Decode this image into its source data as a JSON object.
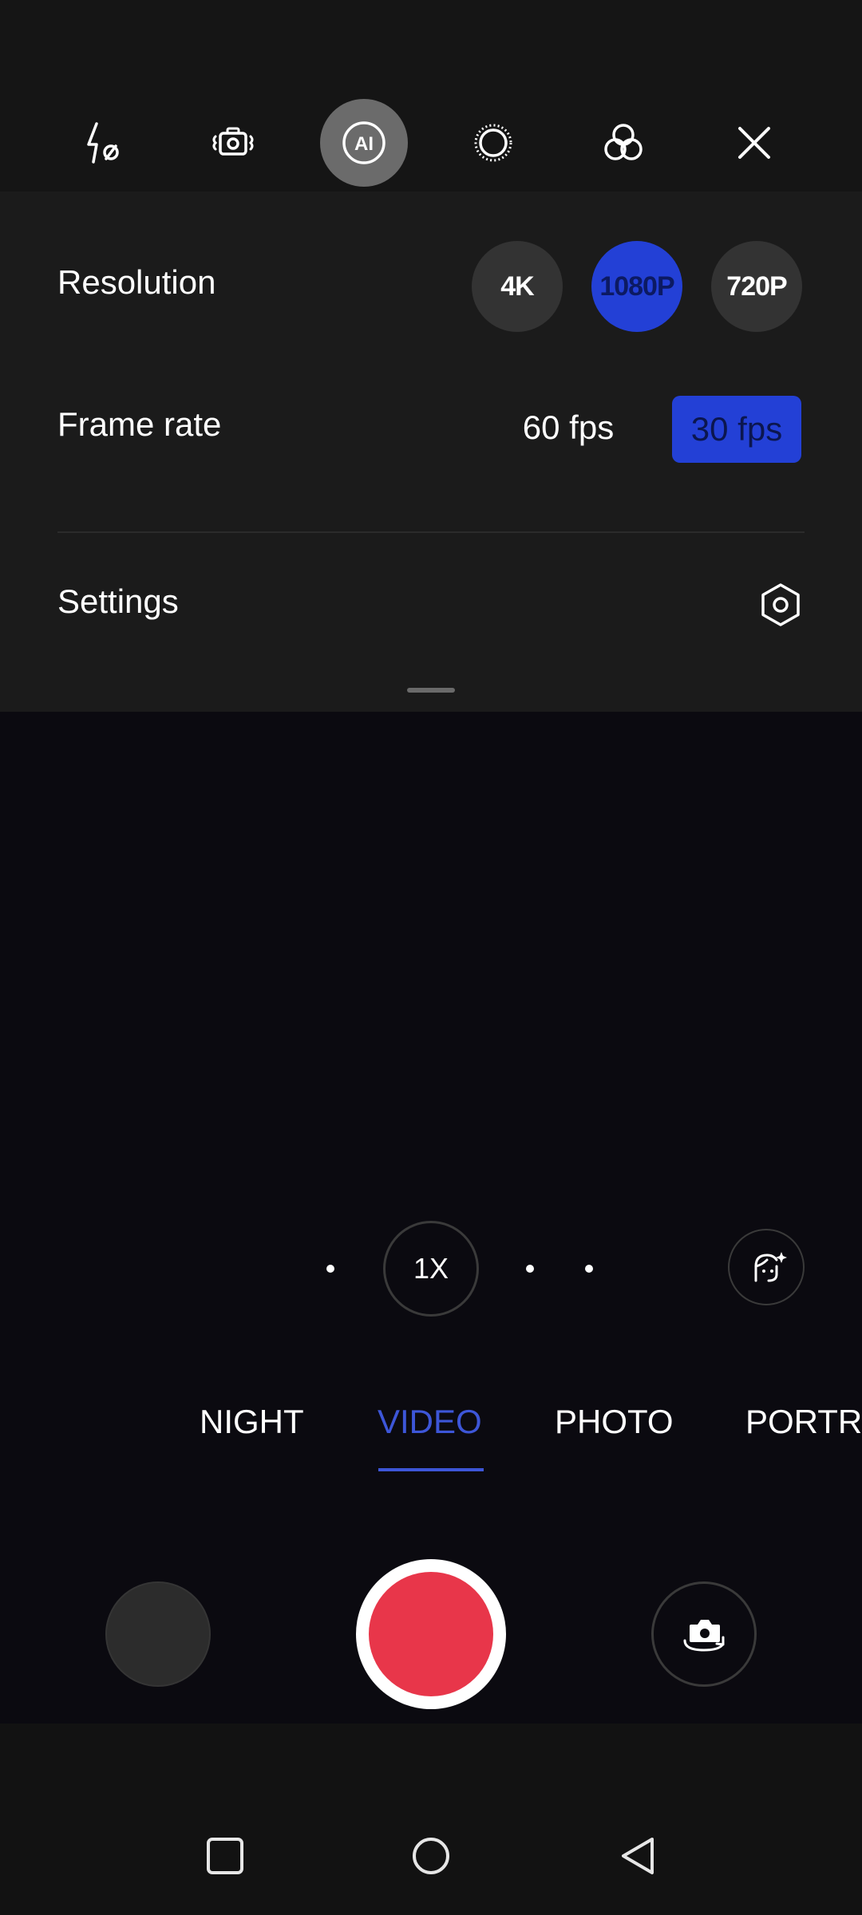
{
  "toolbar": {
    "items": [
      {
        "icon": "flash-off-icon"
      },
      {
        "icon": "stabilization-icon"
      },
      {
        "icon": "ai-icon",
        "label": "AI",
        "active": true
      },
      {
        "icon": "aperture-icon"
      },
      {
        "icon": "filters-icon"
      },
      {
        "icon": "close-icon"
      }
    ]
  },
  "panel": {
    "resolution_label": "Resolution",
    "resolutions": [
      "4K",
      "1080P",
      "720P"
    ],
    "resolution_selected": "1080P",
    "frame_rate_label": "Frame rate",
    "frame_rates": [
      "60 fps",
      "30 fps"
    ],
    "frame_rate_selected": "30 fps",
    "settings_label": "Settings",
    "settings_icon": "gear-hex-icon"
  },
  "zoom": {
    "label": "1X"
  },
  "beauty_icon": "face-beauty-icon",
  "modes": {
    "items": [
      "NIGHT",
      "VIDEO",
      "PHOTO",
      "PORTRAIT"
    ],
    "active": "VIDEO"
  },
  "controls": {
    "shutter_color": "#e8364a",
    "flip_icon": "camera-flip-icon"
  },
  "colors": {
    "accent": "#2340d6",
    "mode_active": "#3d56d8"
  },
  "navbar": {
    "items": [
      "recents-square-icon",
      "home-circle-icon",
      "back-triangle-icon"
    ]
  }
}
